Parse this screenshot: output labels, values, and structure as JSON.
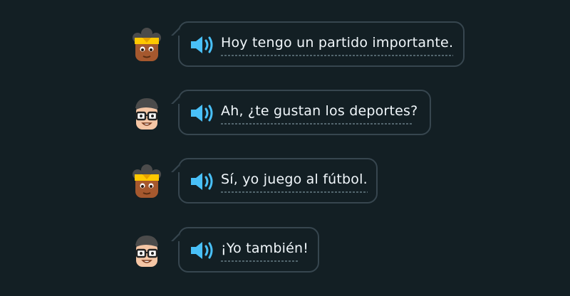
{
  "dialogue": [
    {
      "speaker": "girl",
      "text": "Hoy tengo un partido importante."
    },
    {
      "speaker": "boy",
      "text": "Ah, ¿te gustan los deportes?"
    },
    {
      "speaker": "girl",
      "text": "Sí, yo juego al fútbol."
    },
    {
      "speaker": "boy",
      "text": "¡Yo también!"
    }
  ],
  "colors": {
    "background": "#131f24",
    "bubble_border": "#37464f",
    "text": "#f1f7fb",
    "speaker_icon": "#49c0f8",
    "underline": "#52656d"
  },
  "icons": {
    "speaker": "speaker-icon",
    "girl": "girl-avatar-icon",
    "boy": "boy-avatar-icon"
  }
}
